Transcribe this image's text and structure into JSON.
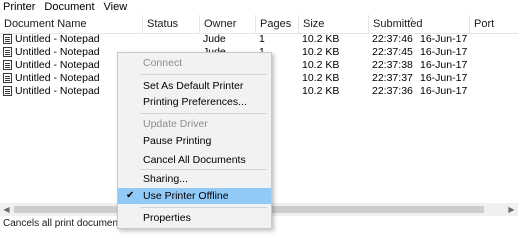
{
  "menubar": {
    "items": [
      "Printer",
      "Document",
      "View"
    ]
  },
  "columns": {
    "document_name": "Document Name",
    "status": "Status",
    "owner": "Owner",
    "pages": "Pages",
    "size": "Size",
    "submitted": "Submitted",
    "port": "Port"
  },
  "rows": [
    {
      "name": "Untitled - Notepad",
      "status": "",
      "owner": "Jude",
      "pages": "1",
      "size": "10.2 KB",
      "time": "22:37:46",
      "date": "16-Jun-17"
    },
    {
      "name": "Untitled - Notepad",
      "status": "",
      "owner": "Jude",
      "pages": "1",
      "size": "10.2 KB",
      "time": "22:37:45",
      "date": "16-Jun-17"
    },
    {
      "name": "Untitled - Notepad",
      "status": "",
      "owner": "",
      "pages": "1",
      "size": "10.2 KB",
      "time": "22:37:38",
      "date": "16-Jun-17"
    },
    {
      "name": "Untitled - Notepad",
      "status": "",
      "owner": "",
      "pages": "1",
      "size": "10.2 KB",
      "time": "22:37:37",
      "date": "16-Jun-17"
    },
    {
      "name": "Untitled - Notepad",
      "status": "",
      "owner": "",
      "pages": "1",
      "size": "10.2 KB",
      "time": "22:37:36",
      "date": "16-Jun-17"
    }
  ],
  "context_menu": {
    "connect": "Connect",
    "set_default": "Set As Default Printer",
    "printing_prefs": "Printing Preferences...",
    "update_driver": "Update Driver",
    "pause_printing": "Pause Printing",
    "cancel_all": "Cancel All Documents",
    "sharing": "Sharing...",
    "use_offline": "Use Printer Offline",
    "properties": "Properties",
    "check_glyph": "✔"
  },
  "scrollbar": {
    "left_arrow": "◀",
    "right_arrow": "▶"
  },
  "statusbar": {
    "text": "Cancels all print documents on"
  },
  "colors": {
    "highlight": "#91c9f7",
    "menu_bg": "#f2f2f2",
    "disabled_text": "#8d8d8d"
  }
}
